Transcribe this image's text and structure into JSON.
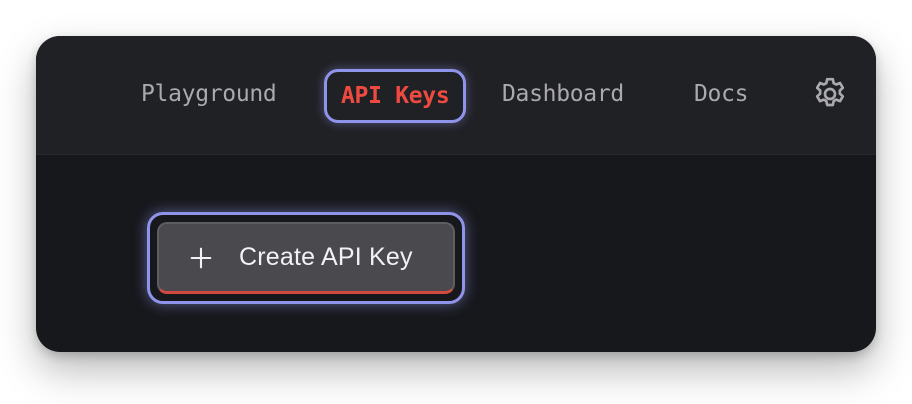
{
  "nav": {
    "items": [
      {
        "label": "Playground"
      },
      {
        "label": "API Keys"
      },
      {
        "label": "Dashboard"
      },
      {
        "label": "Docs"
      }
    ],
    "settings_icon": "gear-icon"
  },
  "actions": {
    "create_label": "Create API Key",
    "create_icon": "plus-icon"
  },
  "colors": {
    "background": "#17181c",
    "topbar": "#202125",
    "focus_ring": "#8f94ea",
    "active_nav": "#ef4a40",
    "button": "#4a4a4e",
    "button_accent": "#d24a3f"
  }
}
